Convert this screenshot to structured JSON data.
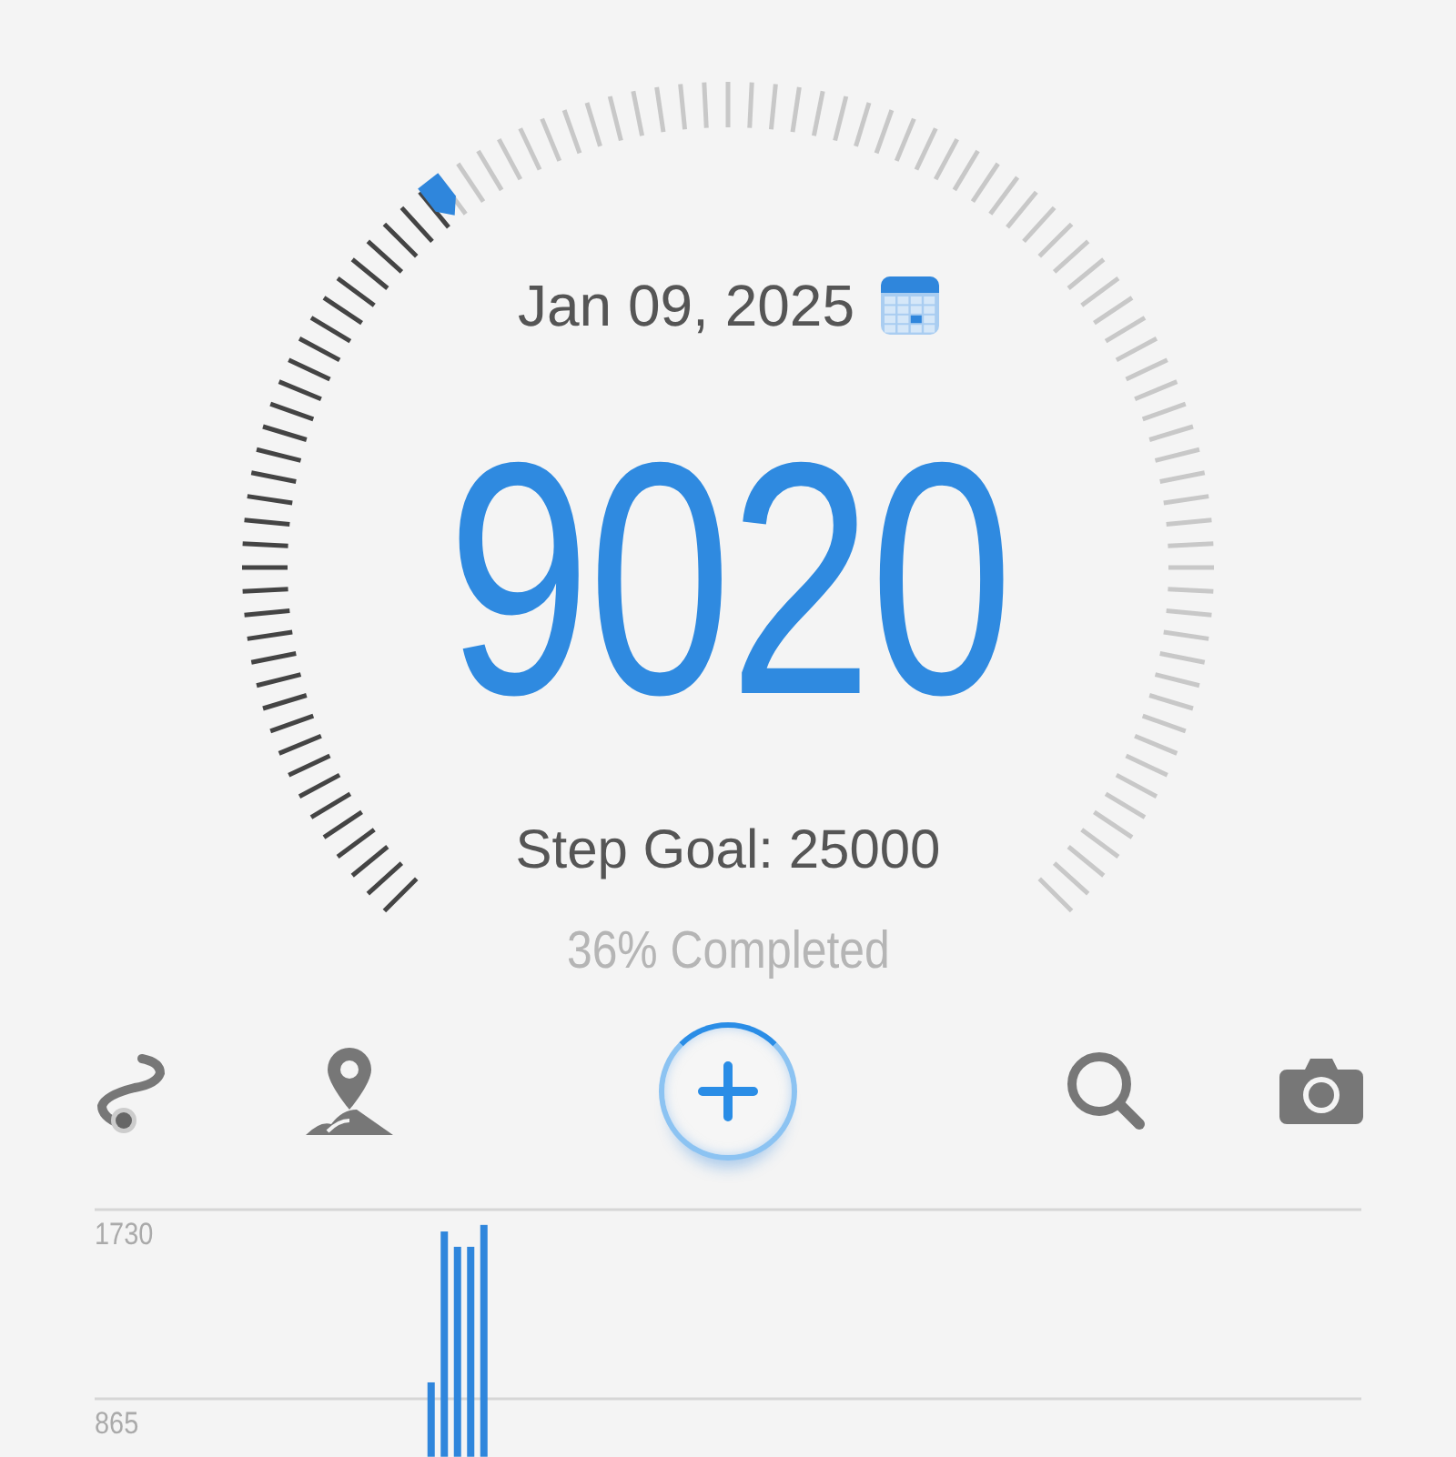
{
  "date": "Jan 09, 2025",
  "steps": "9020",
  "goal": "Step Goal: 25000",
  "completed": "36% Completed",
  "toolbar": [
    {
      "kind": "route"
    },
    {
      "kind": "map"
    },
    {
      "kind": "add"
    },
    {
      "kind": "search"
    },
    {
      "kind": "camera"
    }
  ],
  "chart": {
    "chart_data": {
      "type": "bar",
      "ylim": [
        600,
        1730
      ],
      "yticks": [
        865,
        1730
      ],
      "values": [
        null,
        null,
        null,
        null,
        null,
        null,
        null,
        null,
        null,
        null,
        null,
        null,
        null,
        null,
        null,
        null,
        null,
        null,
        null,
        null,
        null,
        null,
        null,
        null,
        null,
        940,
        1630,
        1560,
        1560,
        1660,
        null,
        null,
        null,
        null,
        null,
        null,
        null,
        null,
        null,
        null,
        null,
        null,
        null,
        null,
        null,
        null,
        null,
        null,
        null,
        null,
        null,
        null,
        null,
        null,
        null,
        null,
        null,
        null,
        null,
        null,
        null,
        null,
        null,
        null,
        null,
        null,
        null,
        null,
        null,
        null,
        null,
        null,
        null,
        null,
        null,
        null,
        null,
        null,
        null,
        null,
        null,
        null,
        null,
        null,
        null,
        null,
        null,
        null,
        null,
        null,
        null,
        null,
        null,
        null,
        null,
        null
      ]
    }
  }
}
